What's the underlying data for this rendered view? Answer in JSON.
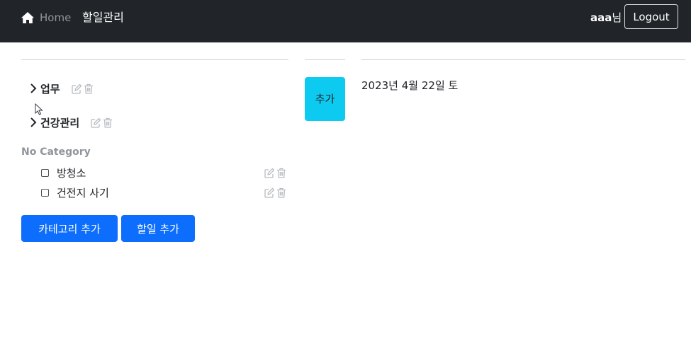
{
  "navbar": {
    "home_icon": "home-icon",
    "home_label": "Home",
    "todo_link": "할일관리",
    "username": "aaa",
    "user_suffix": "님",
    "logout_label": "Logout"
  },
  "categories": [
    {
      "name": "업무",
      "icons": [
        "chevron-right-icon",
        "edit-icon",
        "trash-icon"
      ]
    },
    {
      "name": "건강관리",
      "icons": [
        "chevron-right-icon",
        "edit-icon",
        "trash-icon"
      ]
    }
  ],
  "no_category": {
    "label": "No Category",
    "todos": [
      {
        "text": "방청소",
        "checked": false
      },
      {
        "text": "건전지 사기",
        "checked": false
      }
    ]
  },
  "buttons": {
    "add_category": "카테고리 추가",
    "add_todo": "할일 추가",
    "add": "추가"
  },
  "calendar": {
    "date": "2023년 4월 22일 토"
  },
  "colors": {
    "navbar_bg": "#212529",
    "primary": "#0d6efd",
    "info": "#0dcaf0"
  }
}
